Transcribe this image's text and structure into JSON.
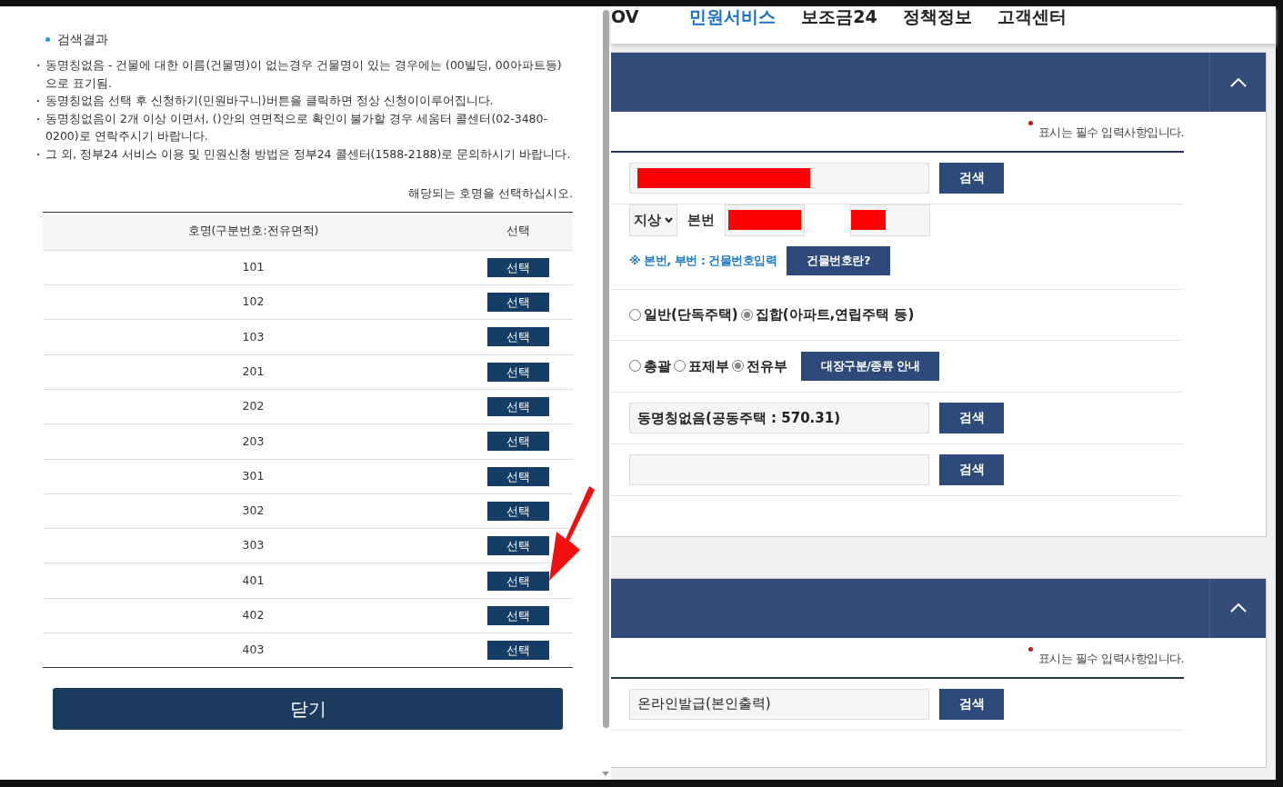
{
  "popup": {
    "section_title": "검색결과",
    "notes": [
      "동명칭없음 - 건물에 대한 이름(건물명)이 없는경우 건물명이 있는 경우에는 (00빌딩, 00아파트등)으로 표기됨.",
      "동명칭없음 선택 후 신청하기(민원바구니)버튼을 클릭하면 정상 신청이이루어집니다.",
      "동명칭없음이 2개 이상 이면서, ()안의 연면적으로 확인이 불가할 경우 세움터 콜센터(02-3480-0200)로 연락주시기 바랍니다.",
      "그 외, 정부24 서비스 이용 및 민원신청 방법은 정부24 콜센터(1588-2188)로 문의하시기 바랍니다."
    ],
    "instruction": "해당되는 호명을 선택하십시오.",
    "table": {
      "columns": [
        "호명(구분번호:전유면적)",
        "선택"
      ],
      "rows": [
        {
          "unit": "101",
          "button": "선택"
        },
        {
          "unit": "102",
          "button": "선택"
        },
        {
          "unit": "103",
          "button": "선택"
        },
        {
          "unit": "201",
          "button": "선택"
        },
        {
          "unit": "202",
          "button": "선택"
        },
        {
          "unit": "203",
          "button": "선택"
        },
        {
          "unit": "301",
          "button": "선택"
        },
        {
          "unit": "302",
          "button": "선택"
        },
        {
          "unit": "303",
          "button": "선택"
        },
        {
          "unit": "401",
          "button": "선택"
        },
        {
          "unit": "402",
          "button": "선택"
        },
        {
          "unit": "403",
          "button": "선택"
        }
      ]
    },
    "close_button": "닫기"
  },
  "nav": [
    {
      "label": "OV",
      "selected": false
    },
    {
      "label": "민원서비스",
      "selected": true
    },
    {
      "label": "보조금24",
      "selected": false
    },
    {
      "label": "정책정보",
      "selected": false
    },
    {
      "label": "고객센터",
      "selected": false
    }
  ],
  "panels": [
    {
      "required_note": "표시는 필수 입력사항입니다.",
      "rows": [
        {
          "kind": "field",
          "redacted": true,
          "button": "검색"
        },
        {
          "kind": "lot",
          "select": "지상",
          "label": "본번",
          "redacted": true
        },
        {
          "kind": "link",
          "text": "※ 본번, 부번 : 건물번호입력",
          "button": "건물번호란?"
        },
        {
          "kind": "radios",
          "options": [
            {
              "label": "일반(단독주택)",
              "selected": false
            },
            {
              "label": "집합(아파트,연립주택 등)",
              "selected": true
            }
          ]
        },
        {
          "kind": "radios",
          "options": [
            {
              "label": "총괄",
              "selected": false
            },
            {
              "label": "표제부",
              "selected": false
            },
            {
              "label": "전유부",
              "selected": true
            }
          ],
          "button": "대장구분/종류 안내"
        },
        {
          "kind": "field",
          "value": "동명칭없음(공동주택 : 570.31)",
          "bold": true,
          "button": "검색"
        },
        {
          "kind": "field",
          "button": "검색"
        }
      ]
    },
    {
      "required_note": "표시는 필수 입력사항입니다.",
      "rows": [
        {
          "kind": "field",
          "value": "온라인발급(본인출력)",
          "button": "검색"
        }
      ]
    }
  ]
}
